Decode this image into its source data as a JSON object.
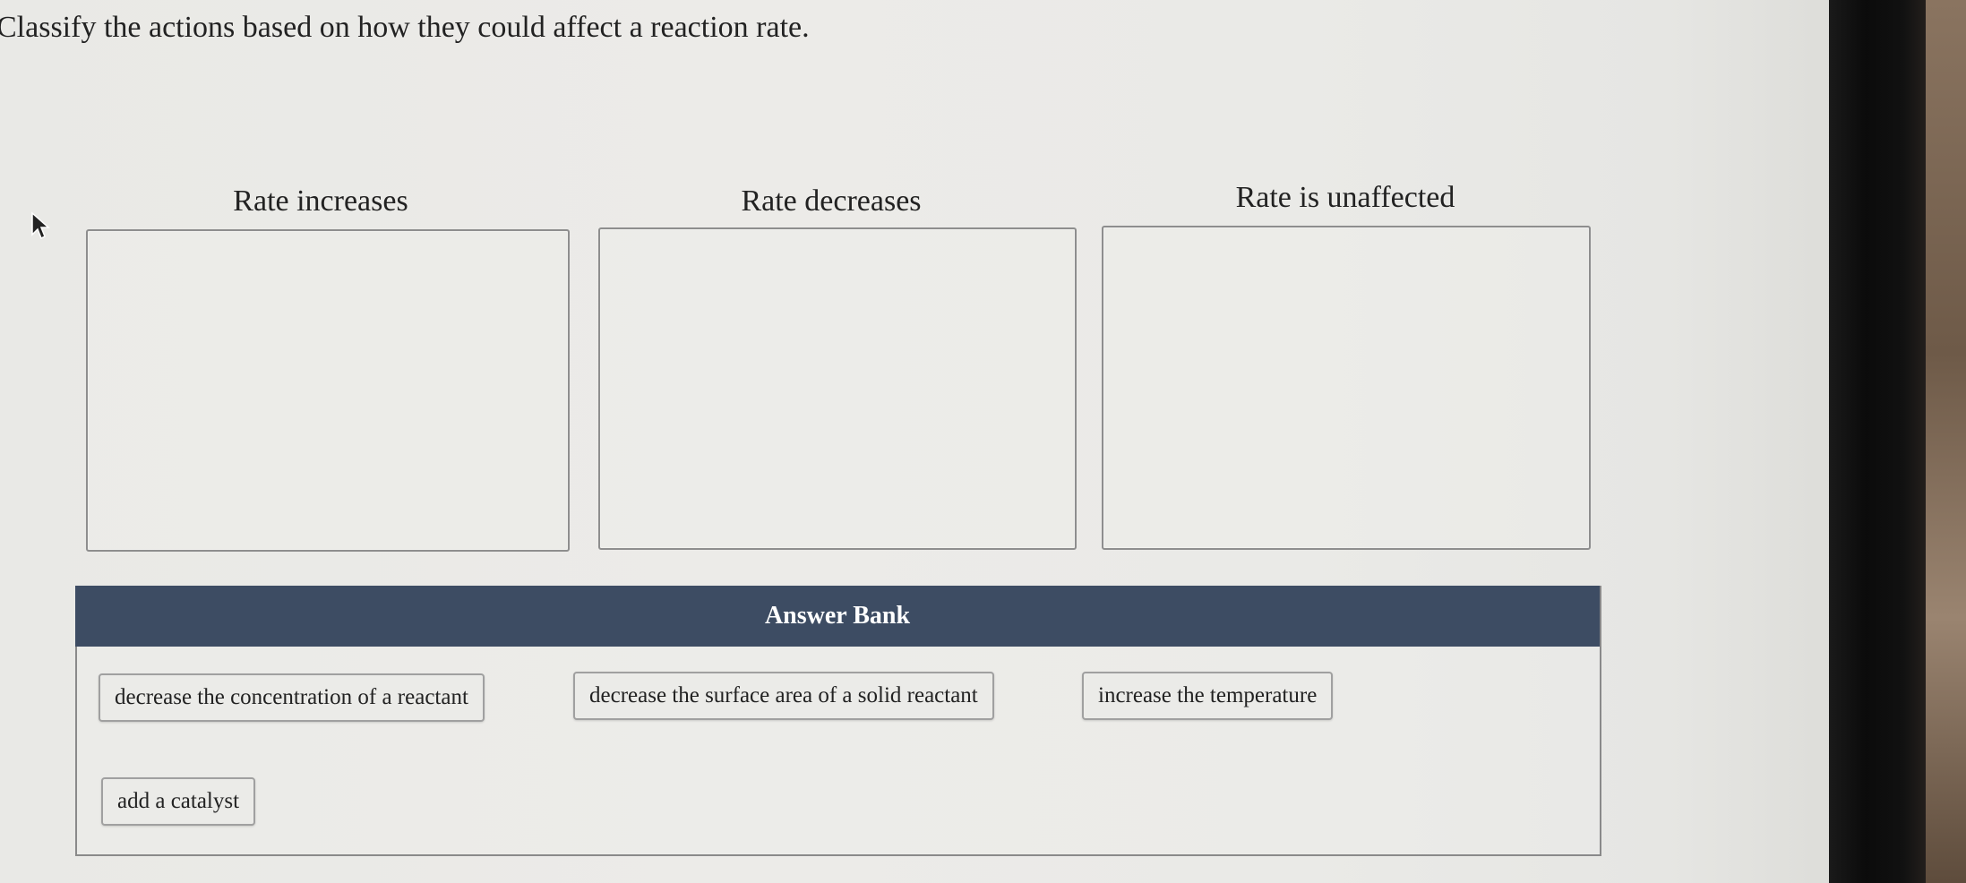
{
  "question": "Classify the actions based on how they could affect a reaction rate.",
  "bins": [
    {
      "label": "Rate increases"
    },
    {
      "label": "Rate decreases"
    },
    {
      "label": "Rate is unaffected"
    }
  ],
  "answer_bank": {
    "title": "Answer Bank",
    "items": [
      "decrease the concentration of a reactant",
      "decrease the surface area of a solid reactant",
      "increase the temperature",
      "add a catalyst"
    ]
  },
  "colors": {
    "bank_header": "#3d4c63",
    "bin_border": "#8e8e8e"
  }
}
